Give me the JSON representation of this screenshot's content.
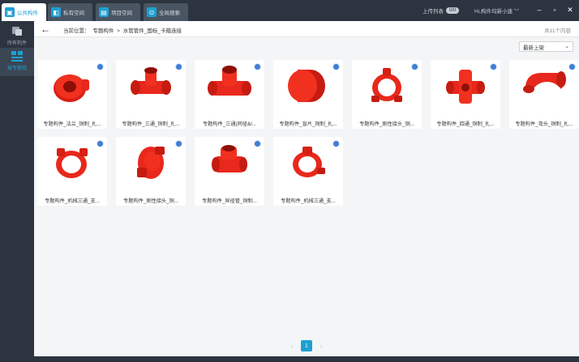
{
  "tabs": [
    {
      "label": "公共构件",
      "icon": "public-library-icon",
      "active": true
    },
    {
      "label": "私有空间",
      "icon": "private-space-icon",
      "active": false
    },
    {
      "label": "项目空间",
      "icon": "project-space-icon",
      "active": false
    },
    {
      "label": "全局搜索",
      "icon": "search-icon",
      "active": false
    }
  ],
  "header": {
    "upload_list_label": "上传列表",
    "upload_count": "0/0",
    "user_greeting": "Hi,构件坞新小速"
  },
  "sidebar": {
    "items": [
      {
        "label": "所有构件",
        "icon": "all-components-icon",
        "active": false
      },
      {
        "label": "按专题找",
        "icon": "topic-grid-icon",
        "active": true
      }
    ]
  },
  "breadcrumb": {
    "prefix": "当前位置：",
    "items": [
      "专题构件",
      "水管管件_国标_卡箍连接"
    ],
    "separator": ">"
  },
  "total_label": "共11个内容",
  "sort": {
    "selected": "最新上架"
  },
  "components": [
    {
      "name": "专题构件_法兰_铜制_扎..."
    },
    {
      "name": "专题构件_三通_铜制_扎..."
    },
    {
      "name": "专题构件_三通(同径&I..."
    },
    {
      "name": "专题构件_盲片_铜制_扎..."
    },
    {
      "name": "专题构件_刚性接头_铜..."
    },
    {
      "name": "专题构件_四通_铜制_扎..."
    },
    {
      "name": "专题构件_弯头_铜制_扎..."
    },
    {
      "name": "专题构件_机械三通_支..."
    },
    {
      "name": "专题构件_刚性接头_铜..."
    },
    {
      "name": "专题构件_异径管_铜制..."
    },
    {
      "name": "专题构件_机械三通_支..."
    }
  ],
  "pagination": {
    "current": "1",
    "prev": "‹",
    "next": "›"
  },
  "colors": {
    "accent": "#1ea0d0",
    "dark": "#2c3440",
    "part_red": "#e8281c"
  }
}
